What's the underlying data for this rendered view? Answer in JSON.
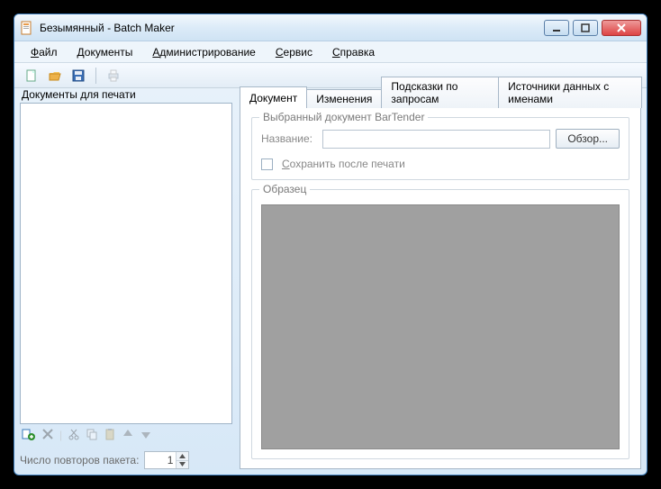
{
  "window": {
    "title": "Безымянный - Batch Maker"
  },
  "menubar": {
    "file": "Файл",
    "documents": "Документы",
    "admin": "Администрирование",
    "service": "Сервис",
    "help": "Справка"
  },
  "left": {
    "label": "Документы для печати",
    "repeat_label": "Число повторов пакета:",
    "repeat_value": "1"
  },
  "tabs": {
    "document": "Документ",
    "changes": "Изменения",
    "prompts": "Подсказки по запросам",
    "named_sources": "Источники данных с именами"
  },
  "doc_group": {
    "legend": "Выбранный документ BarTender",
    "name_label": "Название:",
    "name_value": "",
    "browse": "Обзор...",
    "save_after_print": "Сохранить после печати"
  },
  "preview": {
    "legend": "Образец"
  }
}
